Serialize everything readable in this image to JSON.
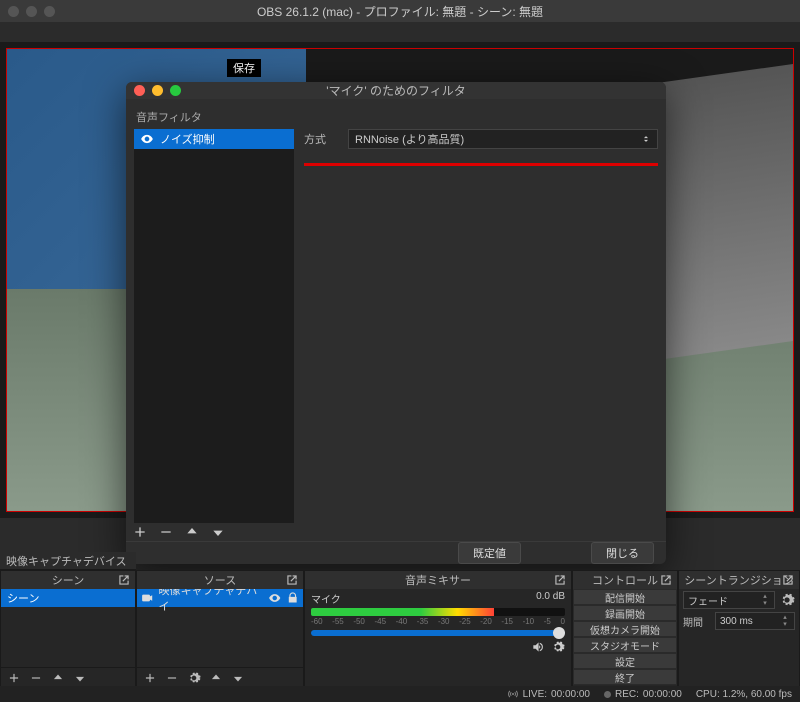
{
  "window": {
    "title": "OBS 26.1.2 (mac) - プロファイル: 無題 - シーン: 無題"
  },
  "preview": {
    "overlay_label": "保存"
  },
  "modal": {
    "title": "'マイク' のためのフィルタ",
    "section_label": "音声フィルタ",
    "filters": [
      {
        "name": "ノイズ抑制"
      }
    ],
    "prop_label": "方式",
    "prop_value": "RNNoise (より高品質)",
    "btn_defaults": "既定値",
    "btn_close": "閉じる"
  },
  "docks": {
    "video_capture_label": "映像キャプチャデバイス",
    "scene": {
      "title": "シーン",
      "items": [
        "シーン"
      ]
    },
    "source": {
      "title": "ソース",
      "items": [
        "映像キャプチャデバイ"
      ]
    },
    "mixer": {
      "title": "音声ミキサー",
      "track": {
        "name": "マイク",
        "level": "0.0 dB",
        "ticks": [
          "-60",
          "-55",
          "-50",
          "-45",
          "-40",
          "-35",
          "-30",
          "-25",
          "-20",
          "-15",
          "-10",
          "-5",
          "0"
        ]
      }
    },
    "controls": {
      "title": "コントロール",
      "buttons": [
        "配信開始",
        "録画開始",
        "仮想カメラ開始",
        "スタジオモード",
        "設定",
        "終了"
      ]
    },
    "transitions": {
      "title": "シーントランジション",
      "select": "フェード",
      "duration_label": "期間",
      "duration_value": "300 ms"
    }
  },
  "status": {
    "live_label": "LIVE:",
    "live_time": "00:00:00",
    "rec_label": "REC:",
    "rec_time": "00:00:00",
    "cpu": "CPU: 1.2%, 60.00 fps"
  }
}
